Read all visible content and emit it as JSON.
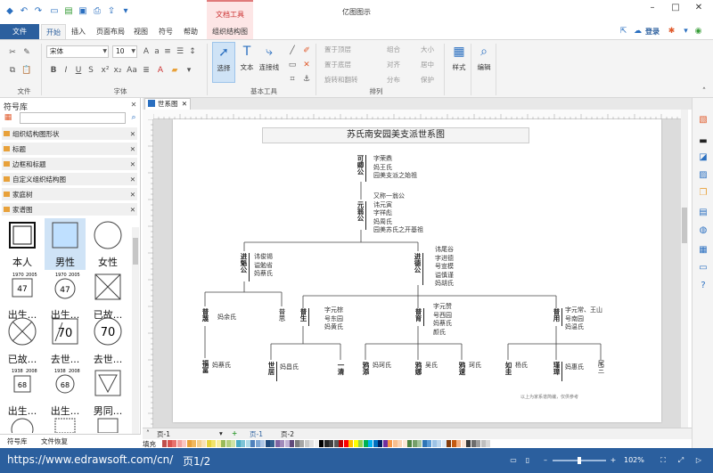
{
  "app": {
    "title": "亿图图示",
    "context_tool": "文档工具",
    "login": "登录"
  },
  "tabs": {
    "file": "文件",
    "items": [
      "开始",
      "插入",
      "页面布局",
      "视图",
      "符号",
      "帮助"
    ],
    "context": "组织结构图"
  },
  "ribbon": {
    "file_group": "文件",
    "font_group": "字体",
    "tools_group": "基本工具",
    "arrange_group": "排列",
    "font_name": "宋体",
    "font_size": "10",
    "select": "选择",
    "text": "文本",
    "connector": "连接线",
    "bring_front": "置于顶层",
    "send_back": "置于底层",
    "rotate_flip": "旋转和翻转",
    "group": "组合",
    "align": "对齐",
    "distribute": "分布",
    "size": "大小",
    "center": "居中",
    "protect": "保护",
    "style": "样式",
    "edit": "编辑"
  },
  "library": {
    "title": "符号库",
    "categories": [
      "组织结构图形状",
      "标题",
      "边框和标题",
      "自定义组织结构图",
      "家庭树",
      "家谱图"
    ],
    "shapes": [
      "本人",
      "男性",
      "女性",
      "出生...",
      "出生...",
      "已故...",
      "已故...",
      "去世...",
      "去世...",
      "出生...",
      "出生...",
      "男同..."
    ],
    "shape_years": [
      "1970",
      "2005",
      "1970",
      "2005",
      "1938",
      "2008",
      "1938",
      "2008"
    ],
    "shape_nums": [
      "47",
      "47",
      "70",
      "70",
      "68",
      "68"
    ],
    "bottom_tabs": [
      "符号库",
      "文件恢复"
    ]
  },
  "document": {
    "tab": "世系图",
    "pages": [
      "页-1",
      "页-1",
      "页-2"
    ],
    "fill_label": "填充"
  },
  "diagram": {
    "title": "苏氏南安园美支派世系图",
    "footer": "以上为家系谱简编，仅供参考",
    "persons": [
      {
        "name": "可卿公",
        "notes": [
          "字荣鼎",
          "妈王氏",
          "园美支派之始祖"
        ]
      },
      {
        "name": "元翁公",
        "notes": [
          "又称一翁公",
          "讳元寅",
          "字祥彪",
          "妈周氏",
          "园美苏氏之开基祖"
        ]
      },
      {
        "name": "进魁公",
        "notes": [
          "讳俊锡",
          "谥勉省",
          "妈蔡氏"
        ]
      },
      {
        "name": "进德公",
        "notes": [
          "讳尾谷",
          "字进德",
          "号宣模",
          "谥慎谨",
          "妈胡氏"
        ]
      },
      {
        "name": "普蔑",
        "notes": [
          "妈余氏"
        ]
      },
      {
        "name": "普思",
        "notes": []
      },
      {
        "name": "普生",
        "notes": [
          "字元棕",
          "号东园",
          "妈黄氏"
        ]
      },
      {
        "name": "普育",
        "notes": [
          "字元赞",
          "号西园",
          "妈蔡氏",
          "颜氏"
        ]
      },
      {
        "name": "普用",
        "notes": [
          "字元常、王山",
          "号南园",
          "妈温氏"
        ]
      },
      {
        "name": "福富",
        "notes": [
          "妈蔡氏"
        ]
      },
      {
        "name": "世居",
        "notes": [
          "妈昌氏"
        ]
      },
      {
        "name": "一清",
        "notes": []
      },
      {
        "name": "鸦添",
        "notes": [
          "妈珂氏"
        ]
      },
      {
        "name": "鸦娜",
        "notes": [
          "吴氏"
        ]
      },
      {
        "name": "鸦速",
        "notes": [
          "珂氏"
        ]
      },
      {
        "name": "如圭",
        "notes": [
          "杨氏"
        ]
      },
      {
        "name": "瑾璋",
        "notes": [
          "妈惠氏"
        ]
      },
      {
        "name": "尾三",
        "notes": []
      }
    ]
  },
  "status": {
    "url": "https://www.edrawsoft.com/cn/",
    "page": "页1/2",
    "zoom": "102%"
  },
  "colors": {
    "brand": "#2b5f9e",
    "swatches": [
      "#c0504d",
      "#d9534f",
      "#e8726e",
      "#f2a09d",
      "#f9c6c4",
      "#e8a13a",
      "#f0b860",
      "#f5cf8c",
      "#f9e2b8",
      "#e6d33c",
      "#f2e46b",
      "#f8ef9f",
      "#9bbb59",
      "#b5d07e",
      "#cfe3a6",
      "#4bacc6",
      "#7dc4d7",
      "#b0dbe8",
      "#4f81bd",
      "#7ea6d3",
      "#aec6e6",
      "#1f497d",
      "#34608f",
      "#8064a2",
      "#a08bbb",
      "#c2b3d5",
      "#604a7b",
      "#7f7f7f",
      "#a5a5a5",
      "#c9c9c9",
      "#e1e1e1",
      "#f2f2f2",
      "#000000",
      "#262626",
      "#404040",
      "#595959",
      "#c00000",
      "#ff0000",
      "#ffc000",
      "#ffff00",
      "#92d050",
      "#00b050",
      "#00b0f0",
      "#0070c0",
      "#002060",
      "#7030a0",
      "#f79646",
      "#fac08f",
      "#fbd5b5",
      "#fde9d9",
      "#4e8542",
      "#76a06a",
      "#a3c49b",
      "#2e75b6",
      "#5b9bd5",
      "#9dc3e6",
      "#bdd7ee",
      "#ddebf7",
      "#843c0c",
      "#c55a11",
      "#f4b183",
      "#fbe5d6",
      "#3a3a3a",
      "#6d6d6d",
      "#9e9e9e",
      "#bfbfbf",
      "#d9d9d9",
      "#ffffff"
    ]
  }
}
